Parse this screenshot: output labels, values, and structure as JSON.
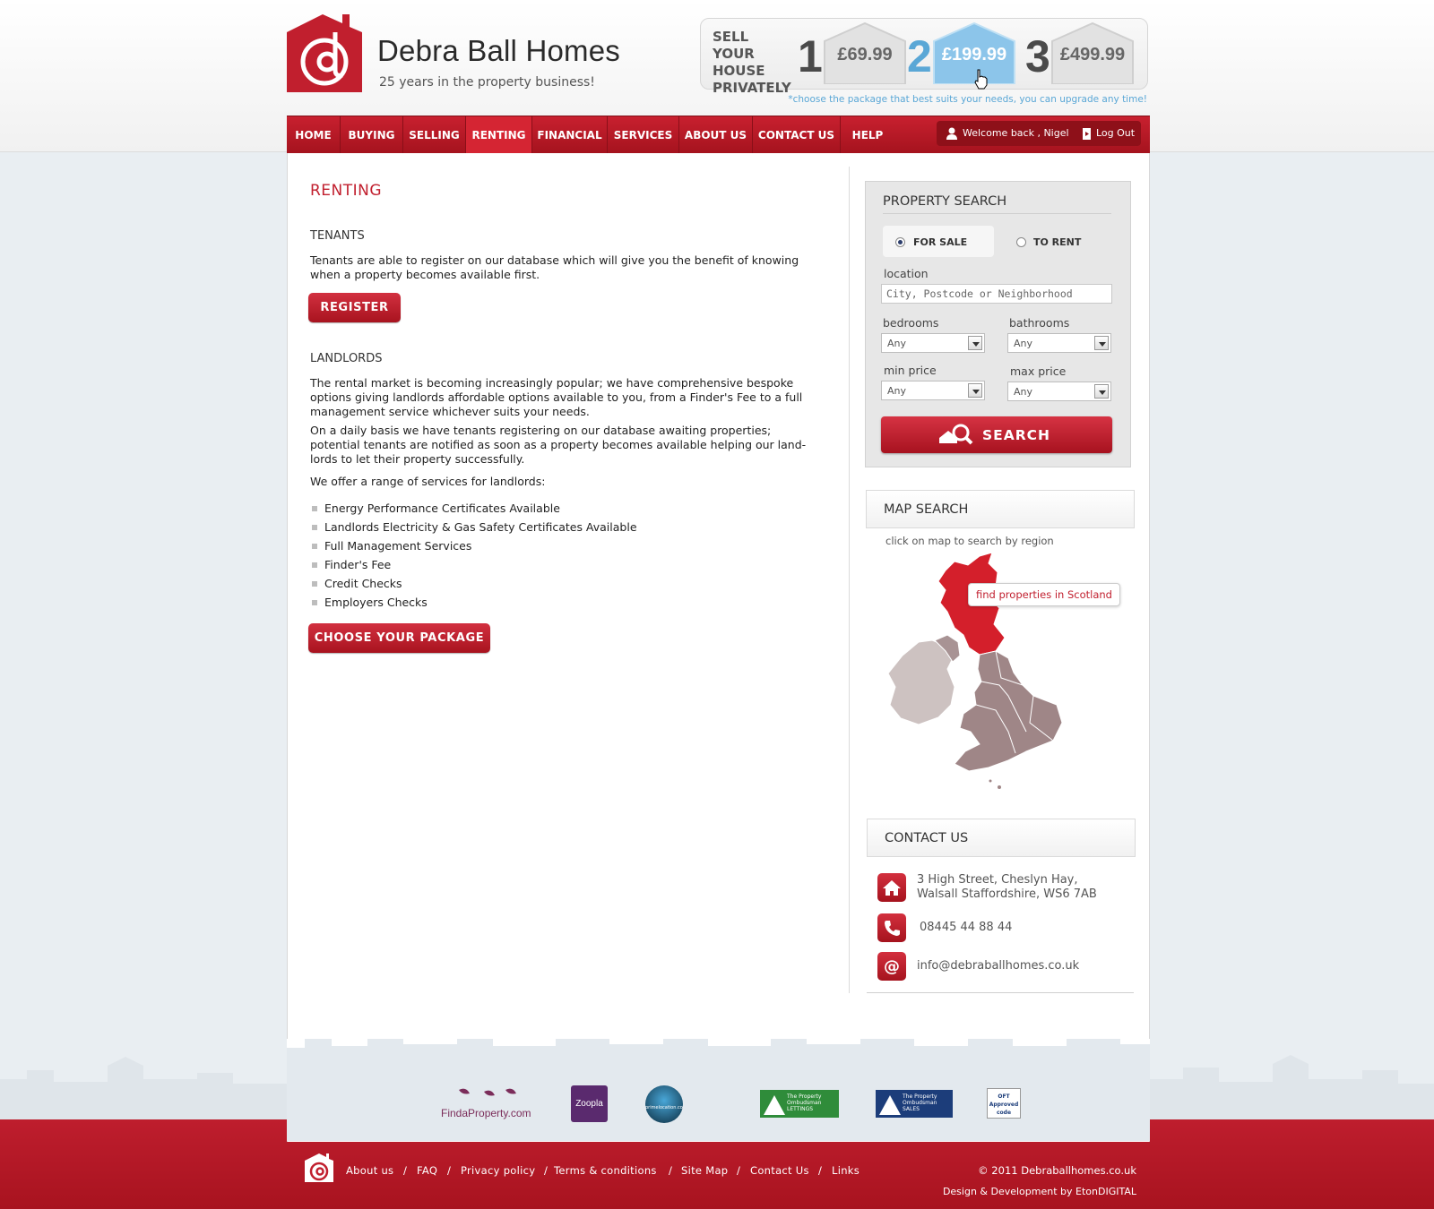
{
  "brand": {
    "name": "Debra Ball Homes",
    "tagline": "25 years in the property business!"
  },
  "sell_privately": {
    "label_lines": [
      "SELL YOUR",
      "HOUSE",
      "PRIVATELY"
    ],
    "packages": [
      {
        "number": "1",
        "price": "£69.99"
      },
      {
        "number": "2",
        "price": "£199.99"
      },
      {
        "number": "3",
        "price": "£499.99"
      }
    ],
    "active_package": "2",
    "note": "*choose the package that best suits your needs, you can upgrade any time!"
  },
  "nav": {
    "items": [
      "HOME",
      "BUYING",
      "SELLING",
      "RENTING",
      "FINANCIAL",
      "SERVICES",
      "ABOUT US",
      "CONTACT US",
      "HELP"
    ],
    "active": "RENTING",
    "welcome": "Welcome back , Nigel",
    "logout": "Log Out"
  },
  "main": {
    "title": "RENTING",
    "tenants": {
      "heading": "TENANTS",
      "text": "Tenants are able to register on our database which will give you the benefit of knowing when a property becomes available first.",
      "button": "REGISTER"
    },
    "landlords": {
      "heading": "LANDLORDS",
      "para1": "The rental market is becoming increasingly popular; we have comprehensive bespoke options giving landlords affordable options available to you, from a Finder's Fee to a full management service whichever suits your needs.",
      "para2": "On a daily basis we have tenants registering on our database awaiting properties; potential tenants are notified as soon as a property becomes available helping our land-lords to let their property successfully.",
      "para3": "We offer a range of services for landlords:",
      "services": [
        "Energy Performance Certificates Available",
        "Landlords Electricity & Gas Safety Certificates Available",
        "Full Management Services",
        "Finder's Fee",
        "Credit Checks",
        "Employers Checks"
      ],
      "button": "CHOOSE YOUR PACKAGE"
    }
  },
  "property_search": {
    "title": "PROPERTY SEARCH",
    "for_sale": "FOR SALE",
    "to_rent": "TO RENT",
    "selected": "FOR SALE",
    "location_label": "location",
    "location_placeholder": "City, Postcode or Neighborhood",
    "bedrooms_label": "bedrooms",
    "bedrooms_value": "Any",
    "bathrooms_label": "bathrooms",
    "bathrooms_value": "Any",
    "min_price_label": "min price",
    "min_price_value": "Any",
    "max_price_label": "max price",
    "max_price_value": "Any",
    "search_button": "SEARCH"
  },
  "map_search": {
    "title": "MAP SEARCH",
    "hint": "click on map to search by region",
    "tooltip": "find properties in Scotland"
  },
  "contact": {
    "title": "CONTACT US",
    "address_lines": [
      "3 High Street, Cheslyn Hay,",
      "Walsall Staffordshire, WS6 7AB"
    ],
    "phone": "08445 44 88 44",
    "email": "info@debraballhomes.co.uk"
  },
  "partners": [
    "FindaProperty.com",
    "Zoopla",
    "primelocation.com",
    "The Property Ombudsman LETTINGS",
    "The Property Ombudsman SALES",
    "OFT Approved code"
  ],
  "footer": {
    "links": [
      "About us",
      "FAQ",
      "Privacy policy",
      "Terms & conditions",
      "Site Map",
      "Contact Us",
      "Links"
    ],
    "copyright": "© 2011 Debraballhomes.co.uk",
    "credit": "Design & Development by EtonDIGITAL"
  },
  "colors": {
    "brand_red": "#c11f2e",
    "accent_blue": "#5aa7d6"
  }
}
